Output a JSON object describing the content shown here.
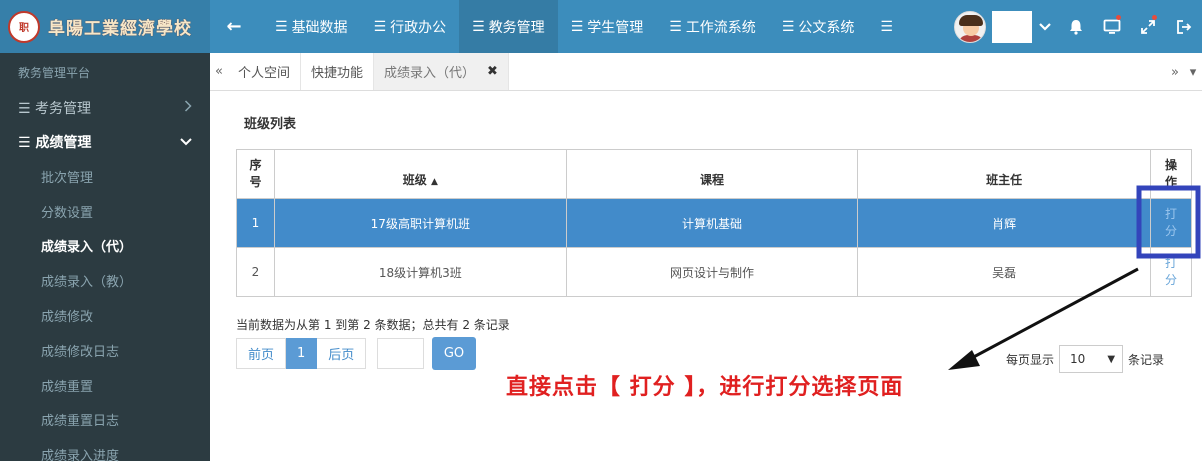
{
  "header": {
    "logo_seal": "职",
    "logo_text": "阜陽工業經濟學校",
    "nav": [
      {
        "label": "基础数据"
      },
      {
        "label": "行政办公"
      },
      {
        "label": "教务管理"
      },
      {
        "label": "学生管理"
      },
      {
        "label": "工作流系统"
      },
      {
        "label": "公文系统"
      }
    ],
    "active_nav": "教务管理"
  },
  "sidebar": {
    "platform_title": "教务管理平台",
    "groups": [
      {
        "label": "考务管理"
      },
      {
        "label": "成绩管理"
      }
    ],
    "items": [
      {
        "label": "批次管理"
      },
      {
        "label": "分数设置"
      },
      {
        "label": "成绩录入（代）"
      },
      {
        "label": "成绩录入（教）"
      },
      {
        "label": "成绩修改"
      },
      {
        "label": "成绩修改日志"
      },
      {
        "label": "成绩重置"
      },
      {
        "label": "成绩重置日志"
      },
      {
        "label": "成绩录入进度"
      }
    ],
    "active_item": "成绩录入（代）"
  },
  "tabs": [
    {
      "label": "个人空间"
    },
    {
      "label": "快捷功能"
    },
    {
      "label": "成绩录入（代）"
    }
  ],
  "main": {
    "section_title": "班级列表",
    "columns": {
      "index": "序号",
      "class": "班级",
      "course": "课程",
      "teacher": "班主任",
      "action": "操作"
    },
    "rows": [
      {
        "index": "1",
        "class": "17级高职计算机班",
        "course": "计算机基础",
        "teacher": "肖辉",
        "action": "打分",
        "selected": true
      },
      {
        "index": "2",
        "class": "18级计算机3班",
        "course": "网页设计与制作",
        "teacher": "吴磊",
        "action": "打分",
        "selected": false
      }
    ],
    "pager_info": "当前数据为从第 1 到第 2 条数据；总共有 2 条记录",
    "prev_label": "前页",
    "current_page": "1",
    "next_label": "后页",
    "go_label": "GO",
    "per_page_prefix": "每页显示",
    "per_page_value": "10",
    "per_page_suffix": "条记录"
  },
  "annotation": {
    "text": "直接点击【 打分 】，进行打分选择页面",
    "color": "#e02020",
    "box_color": "#3344bb"
  },
  "colors": {
    "header": "#3c8dbc",
    "sidebar": "#2c3b41",
    "selected_row": "#428bca"
  }
}
